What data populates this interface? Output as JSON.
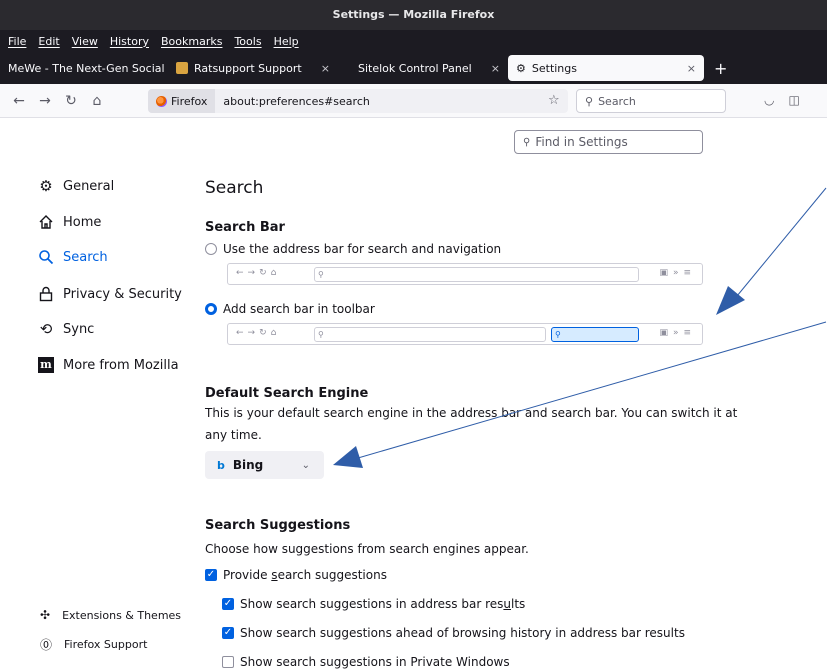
{
  "window": {
    "title": "Settings — Mozilla Firefox"
  },
  "menu": [
    "File",
    "Edit",
    "View",
    "History",
    "Bookmarks",
    "Tools",
    "Help"
  ],
  "tabs": [
    {
      "label": "MeWe - The Next-Gen Social",
      "active": false
    },
    {
      "label": "Ratsupport Support",
      "active": false
    },
    {
      "label": "Sitelok Control Panel",
      "active": false
    },
    {
      "label": "Settings",
      "active": true
    }
  ],
  "tab_close": "×",
  "new_tab": "+",
  "navbar": {
    "identity": "Firefox",
    "url": "about:preferences#search",
    "search_placeholder": "Search"
  },
  "find_placeholder": "Find in Settings",
  "sidebar": {
    "items": [
      {
        "label": "General",
        "icon": "gear-icon"
      },
      {
        "label": "Home",
        "icon": "home-icon"
      },
      {
        "label": "Search",
        "icon": "search-icon",
        "active": true
      },
      {
        "label": "Privacy & Security",
        "icon": "lock-icon"
      },
      {
        "label": "Sync",
        "icon": "sync-icon"
      },
      {
        "label": "More from Mozilla",
        "icon": "mozilla-logo"
      }
    ],
    "footer": [
      {
        "label": "Extensions & Themes",
        "icon": "puzzle-icon"
      },
      {
        "label": "Firefox Support",
        "icon": "help-icon"
      }
    ]
  },
  "main": {
    "title": "Search",
    "search_bar": {
      "heading": "Search Bar",
      "option1": "Use the address bar for search and navigation",
      "option2": "Add search bar in toolbar",
      "selected": 2
    },
    "default_engine": {
      "heading": "Default Search Engine",
      "desc_line1": "This is your default search engine in the address bar and search bar. You can switch it at",
      "desc_line2": "any time.",
      "engine": "Bing"
    },
    "suggestions": {
      "heading": "Search Suggestions",
      "desc": "Choose how suggestions from search engines appear.",
      "provide": {
        "pre": "Provide ",
        "key": "s",
        "post": "earch suggestions",
        "checked": true
      },
      "address_bar": {
        "pre": "Show search suggestions in address bar res",
        "key": "u",
        "post": "lts",
        "checked": true
      },
      "ahead": {
        "label": "Show search suggestions ahead of browsing history in address bar results",
        "checked": true
      },
      "private": {
        "label": "Show search suggestions in Private Windows",
        "checked": false
      }
    }
  },
  "colors": {
    "accent": "#0061e0",
    "annotation_arrow": "#2f5da8"
  }
}
